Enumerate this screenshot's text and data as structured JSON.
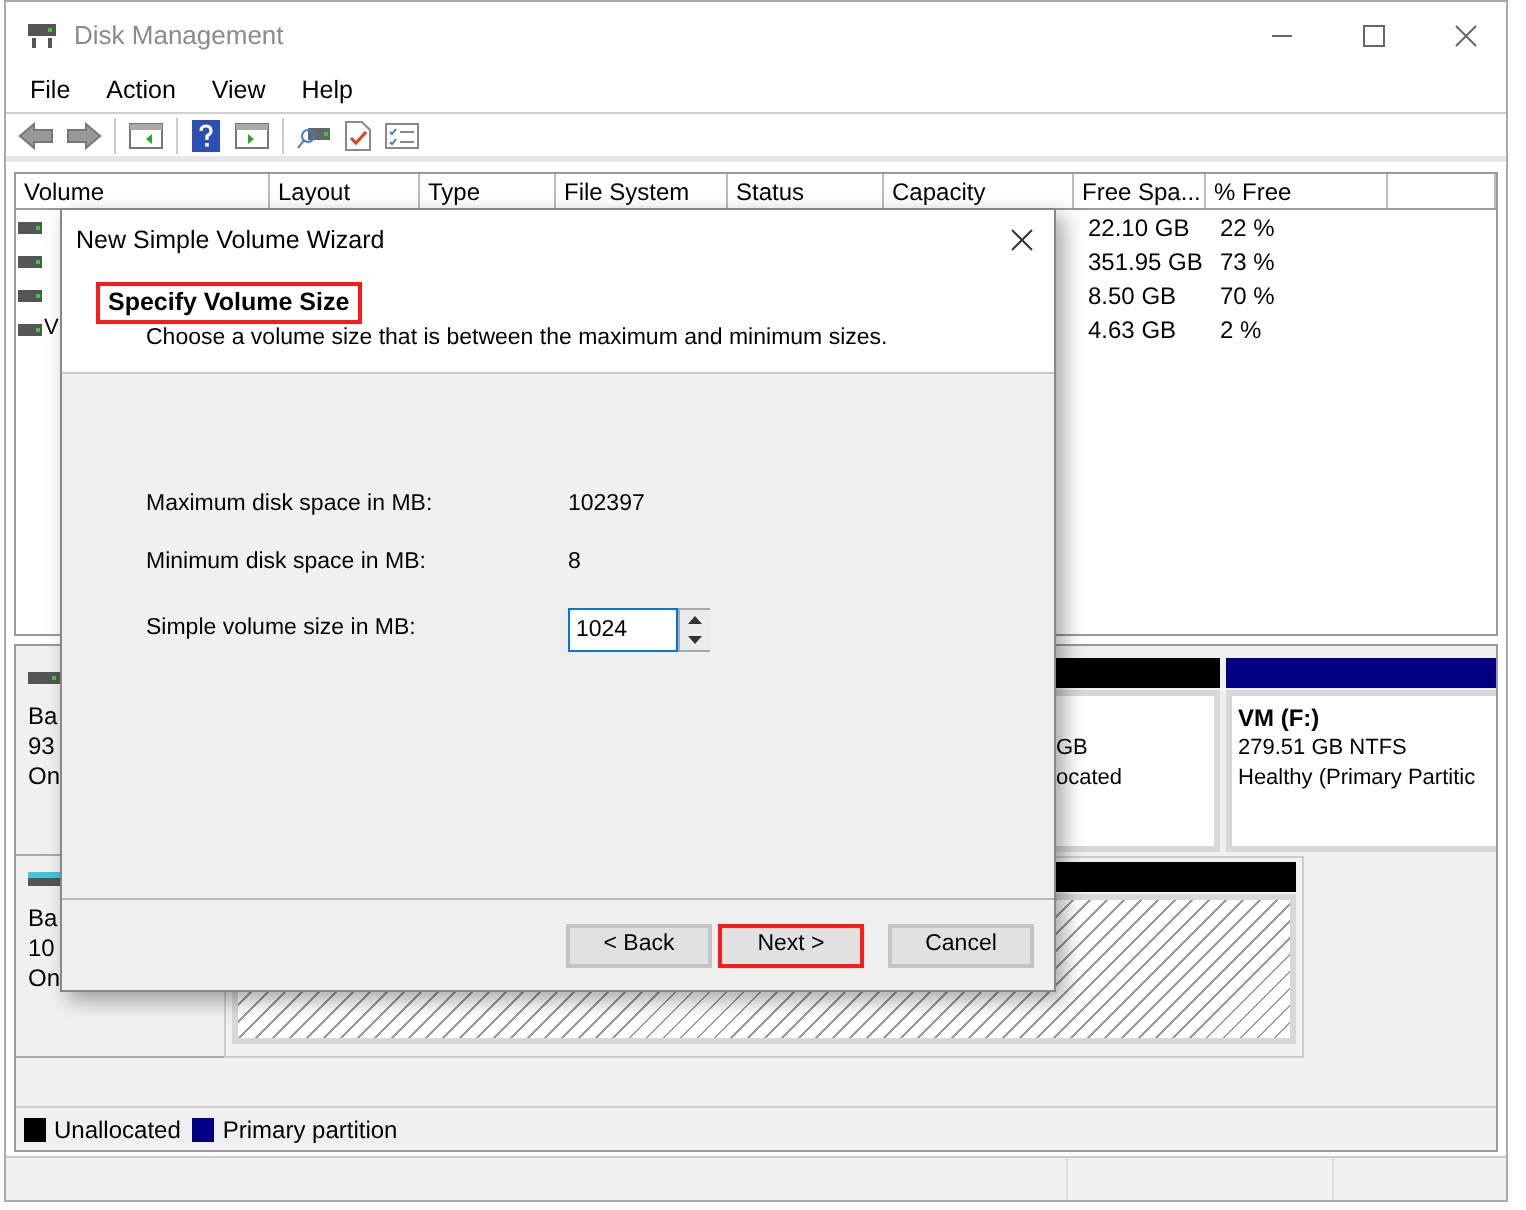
{
  "window": {
    "title": "Disk Management"
  },
  "menu": [
    "File",
    "Action",
    "View",
    "Help"
  ],
  "table": {
    "columns": [
      "Volume",
      "Layout",
      "Type",
      "File System",
      "Status",
      "Capacity",
      "Free Spa...",
      "% Free"
    ],
    "rows": [
      {
        "free_space": "22.10 GB",
        "percent_free": "22 %"
      },
      {
        "free_space": "351.95 GB",
        "percent_free": "73 %"
      },
      {
        "free_space": "8.50 GB",
        "percent_free": "70 %"
      },
      {
        "volume": "V",
        "free_space": "4.63 GB",
        "percent_free": "2 %"
      }
    ]
  },
  "disks": [
    {
      "lines": [
        "Ba",
        "93",
        "On"
      ],
      "partitions": [
        {
          "kind": "unallocated",
          "lines": [
            "GB",
            "ocated"
          ]
        },
        {
          "kind": "primary",
          "name": "VM  (F:)",
          "lines": [
            "279.51 GB NTFS",
            "Healthy (Primary Partitic"
          ]
        }
      ]
    },
    {
      "lines": [
        "Ba",
        "10",
        "On"
      ],
      "partitions": [
        {
          "kind": "unallocated"
        }
      ]
    }
  ],
  "legend": [
    {
      "label": "Unallocated",
      "color": "#000000"
    },
    {
      "label": "Primary partition",
      "color": "#000080"
    }
  ],
  "dialog": {
    "title": "New Simple Volume Wizard",
    "heading": "Specify Volume Size",
    "heading_highlighted": true,
    "subtitle": "Choose a volume size that is between the maximum and minimum sizes.",
    "fields": [
      {
        "kind": "text",
        "label": "Maximum disk space in MB:",
        "value": "102397"
      },
      {
        "kind": "text",
        "label": "Minimum disk space in MB:",
        "value": "8"
      },
      {
        "kind": "spin",
        "label": "Simple volume size in MB:",
        "value": "1024"
      }
    ],
    "buttons": [
      {
        "label": "< Back",
        "highlighted": false
      },
      {
        "label": "Next >",
        "highlighted": true
      },
      {
        "label": "Cancel",
        "highlighted": false
      }
    ]
  }
}
